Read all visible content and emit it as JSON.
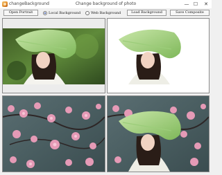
{
  "window": {
    "app_name": "changeBackground",
    "title": "Change background of photo",
    "minimize_glyph": "—",
    "maximize_glyph": "☐",
    "close_glyph": "✕"
  },
  "toolbar": {
    "open_portrait_label": "Open Portrait",
    "local_background_radio_label": "Local Background",
    "local_background_selected": true,
    "web_background_radio_label": "Web Background",
    "web_background_selected": false,
    "load_background_label": "Load Background",
    "save_composite_label": "Save Composite"
  },
  "icons": {
    "app": "app-logo-icon",
    "minimize": "minimize-icon",
    "maximize": "maximize-icon",
    "close": "close-icon"
  },
  "colors": {
    "window_bg": "#f0f0f0",
    "panel_border": "#8a8a8a",
    "radio_selected": "#1f3f9a"
  }
}
